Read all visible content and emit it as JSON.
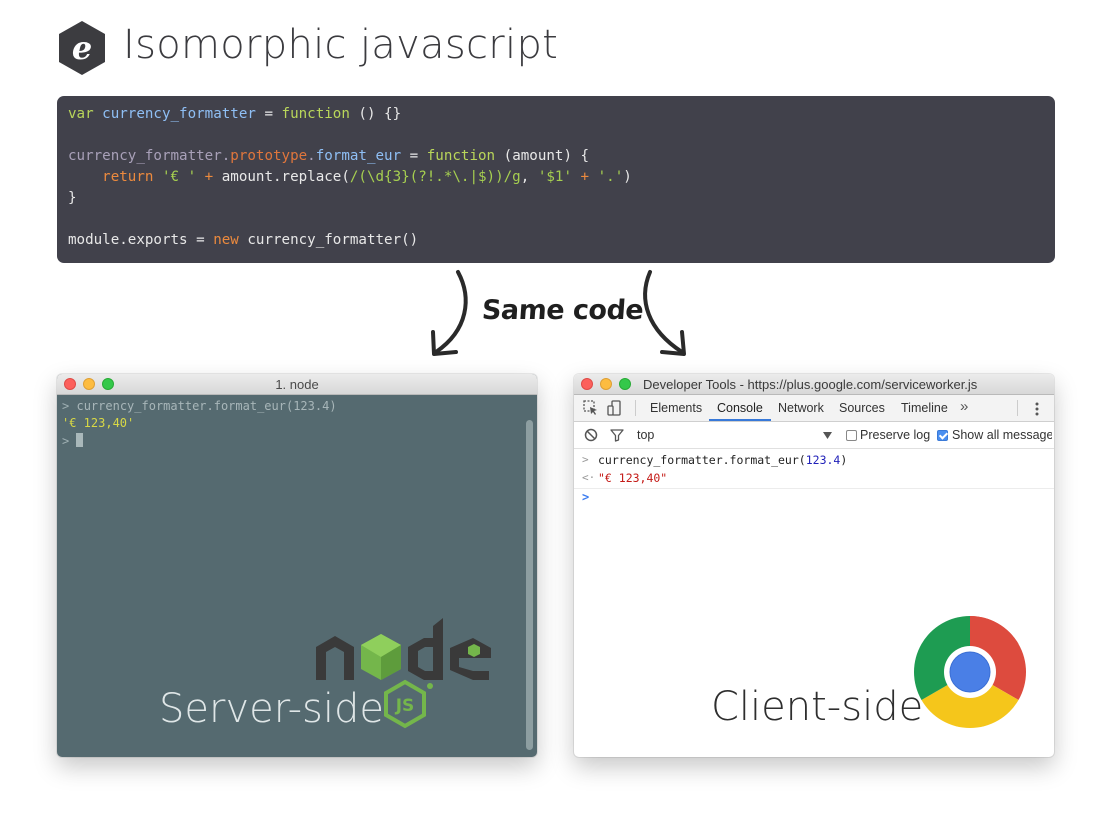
{
  "header": {
    "title": "Isomorphic javascript",
    "logo_letter": "e"
  },
  "code": {
    "l1": {
      "a": "var",
      "b": "currency_formatter",
      "c": " = ",
      "d": "function",
      "e": " () {}"
    },
    "l3": {
      "a": "currency_formatter",
      "b": ".",
      "c": "prototype",
      "d": ".",
      "e": "format_eur",
      "f": " = ",
      "g": "function",
      "h": " (amount) {"
    },
    "l4": {
      "a": "    ",
      "b": "return",
      "c": " ",
      "d": "'€ '",
      "e": " + ",
      "f": "amount.replace(",
      "g": "/(\\d{3}(?!.*\\.|$))/g",
      "h": ", ",
      "i": "'$1'",
      "j": " + ",
      "k": "'.'",
      "l": ")"
    },
    "l5": "}",
    "l7": {
      "a": "module.exports",
      "b": " = ",
      "c": "new",
      "d": " currency_formatter()"
    }
  },
  "middle": {
    "label": "Same code"
  },
  "terminal": {
    "title": "1. node",
    "prompt": ">",
    "command": "currency_formatter.format_eur(123.4)",
    "output": "'€ 123,40'",
    "side_label": "Server-side",
    "logo_word": "node",
    "logo_badge": "JS"
  },
  "devtools": {
    "title": "Developer Tools - https://plus.google.com/serviceworker.js",
    "tabs": [
      "Elements",
      "Console",
      "Network",
      "Sources",
      "Timeline"
    ],
    "active_tab": "Console",
    "more": "»",
    "context": "top",
    "preserve_log": "Preserve log",
    "preserve_log_checked": false,
    "show_all": "Show all messages",
    "show_all_checked": true,
    "input_arrow": ">",
    "output_arrow": "<·",
    "command_fn": "currency_formatter.format_eur(",
    "command_num": "123.4",
    "command_close": ")",
    "result": "\"€ 123,40\"",
    "caret": ">",
    "side_label": "Client-side"
  },
  "colors": {
    "code_bg": "#41414b",
    "terminal_bg": "#556a70",
    "accent": "#3879d9",
    "node_green": "#74b64b"
  }
}
